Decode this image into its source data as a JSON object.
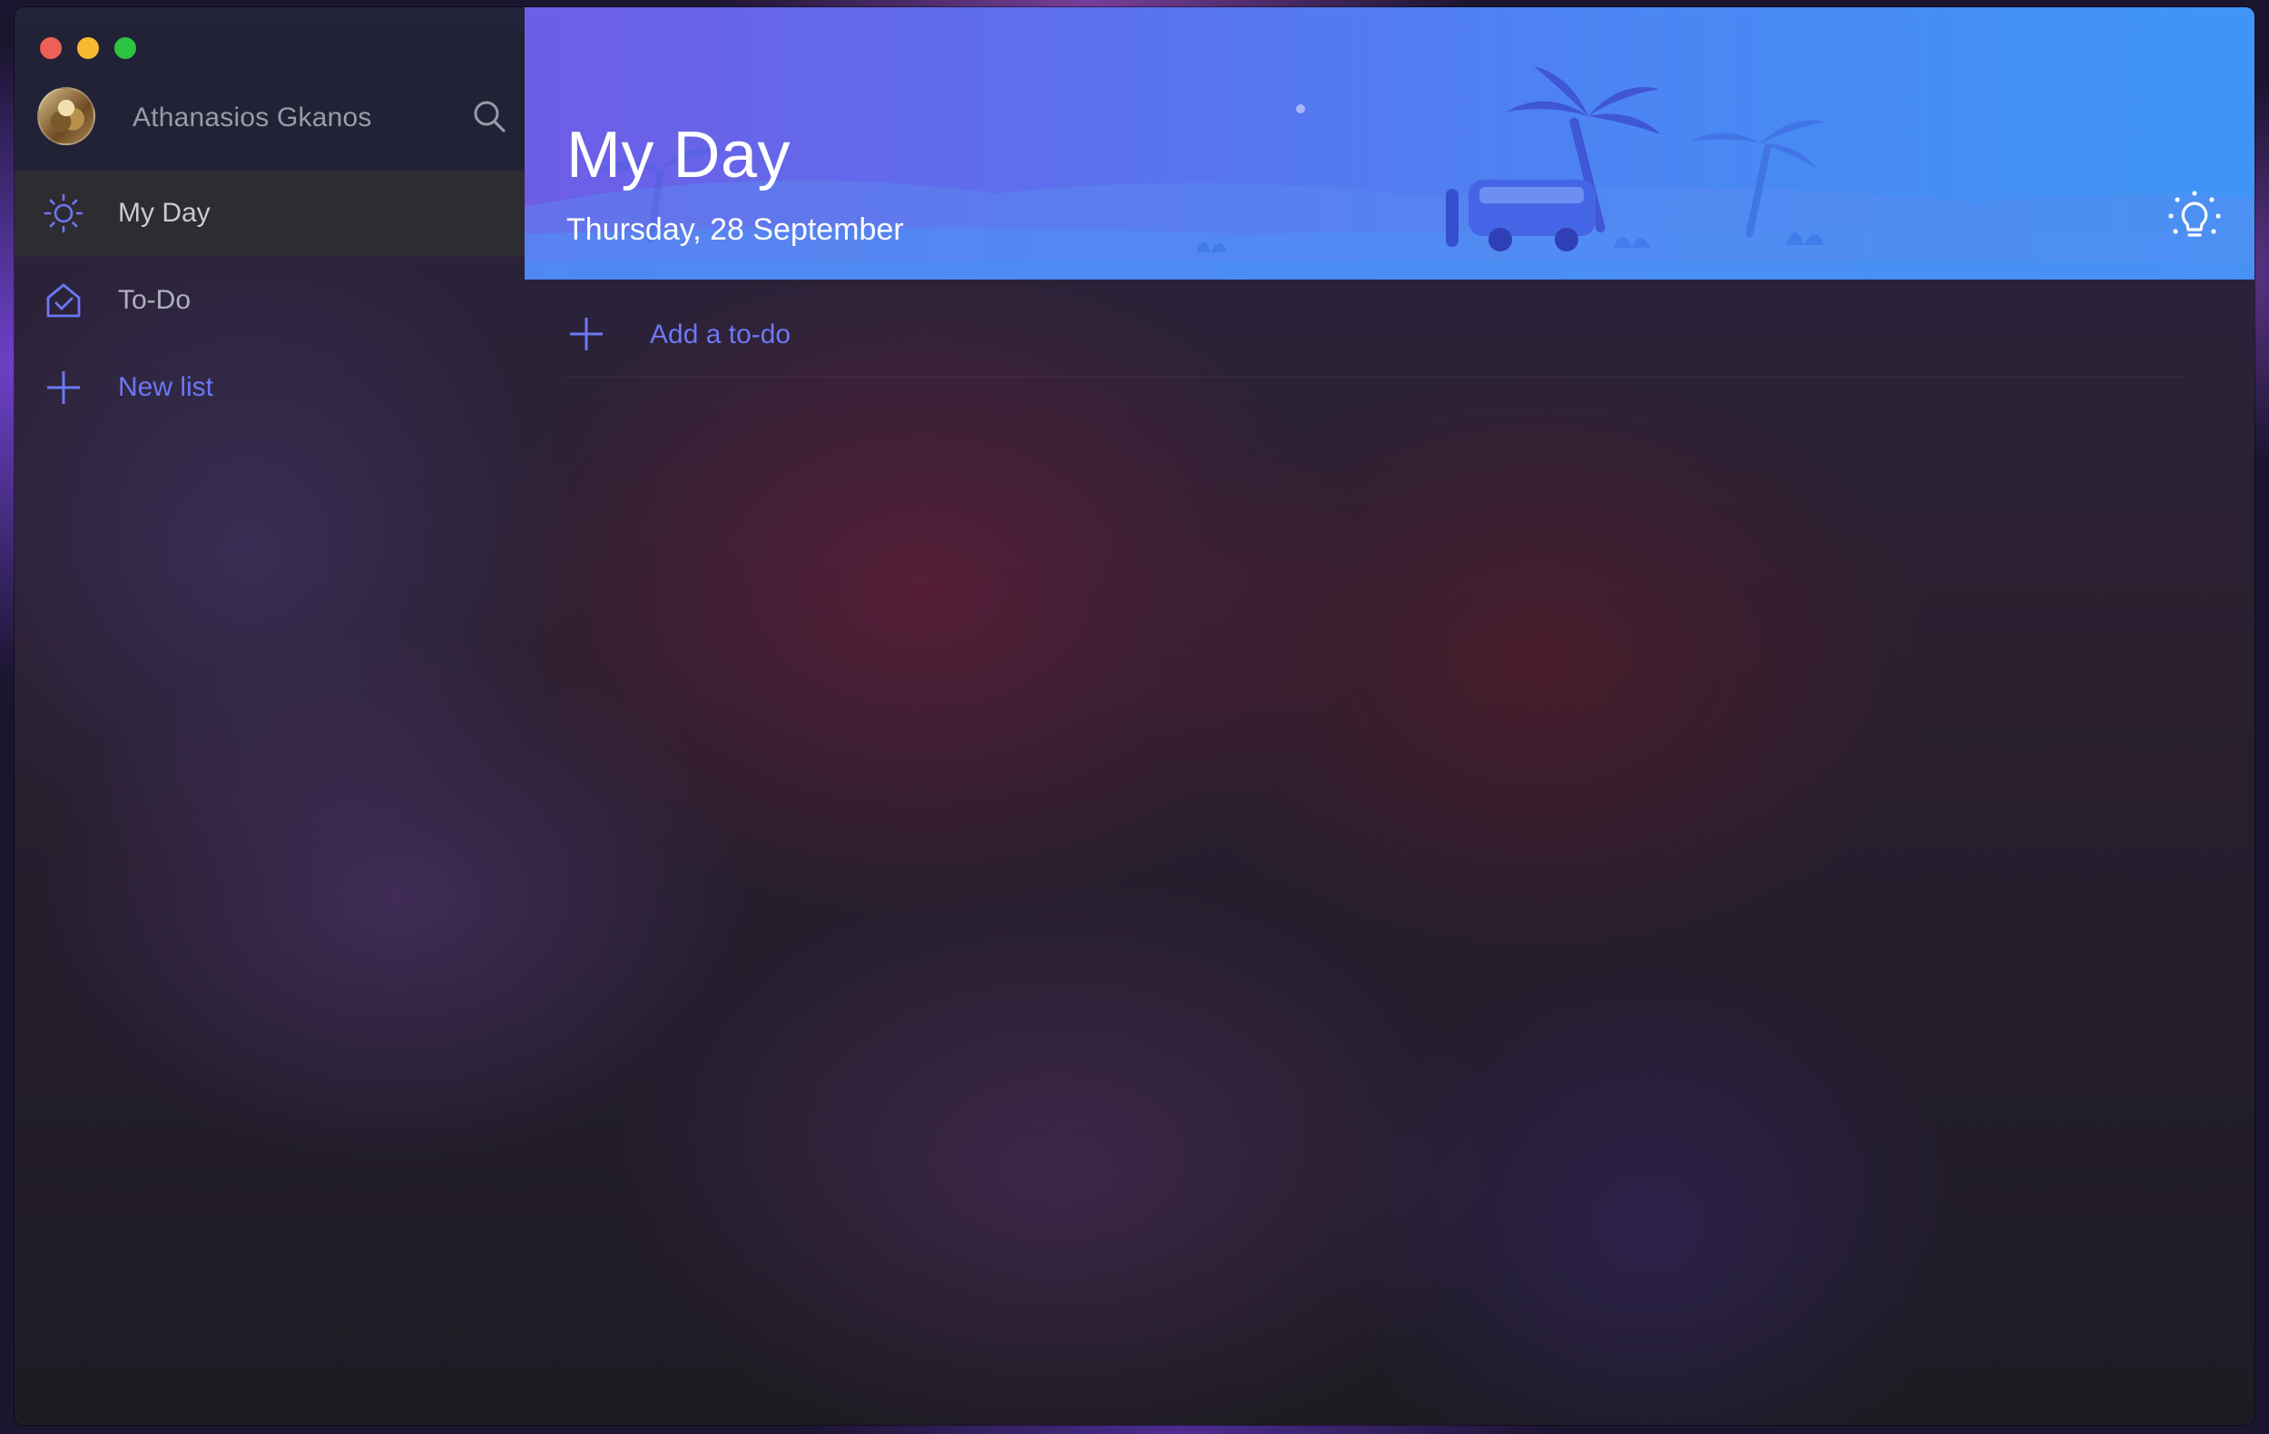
{
  "window": {
    "controls": [
      "close",
      "minimize",
      "maximize"
    ]
  },
  "profile": {
    "name": "Athanasios Gkanos",
    "avatar": "avatar"
  },
  "sidebar": {
    "items": [
      {
        "label": "My Day",
        "icon": "sun-icon",
        "active": true
      },
      {
        "label": "To-Do",
        "icon": "home-check-icon",
        "active": false
      },
      {
        "label": "New list",
        "icon": "plus-icon",
        "active": false
      }
    ]
  },
  "main": {
    "title": "My Day",
    "date": "Thursday, 28 September",
    "add_todo_label": "Add a to-do",
    "suggestions_icon": "lightbulb-icon"
  },
  "colors": {
    "accent": "#6c78f5",
    "banner_start": "#6d5ee6",
    "banner_end": "#3f95f6",
    "close": "#ee5f57",
    "minimize": "#f6bb2f",
    "maximize": "#2cc440"
  }
}
